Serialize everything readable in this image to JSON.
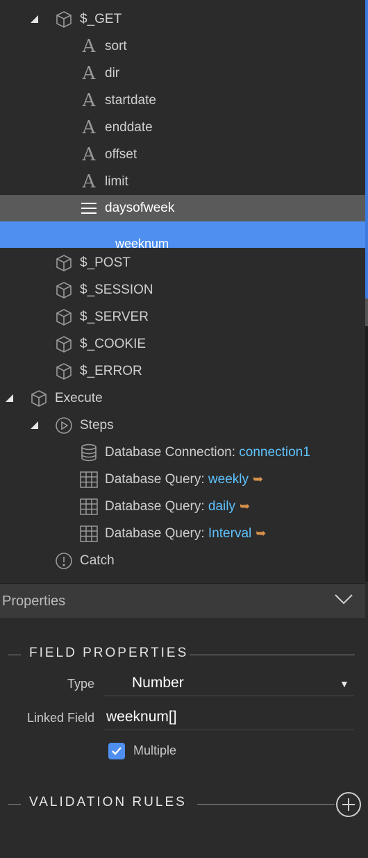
{
  "tree": {
    "get_node": "$_GET",
    "get_children": [
      "sort",
      "dir",
      "startdate",
      "enddate",
      "offset",
      "limit"
    ],
    "selected_item": "daysofweek",
    "highlighted_item": "weeknum",
    "globals": [
      "$_POST",
      "$_SESSION",
      "$_SERVER",
      "$_COOKIE",
      "$_ERROR"
    ],
    "execute_label": "Execute",
    "steps_label": "Steps",
    "steps": [
      {
        "prefix": "Database Connection: ",
        "link": "connection1",
        "arrow": ""
      },
      {
        "prefix": "Database Query: ",
        "link": "weekly",
        "arrow": "➥"
      },
      {
        "prefix": "Database Query: ",
        "link": "daily",
        "arrow": "➥"
      },
      {
        "prefix": "Database Query: ",
        "link": "Interval",
        "arrow": "➥"
      }
    ],
    "catch_label": "Catch"
  },
  "properties": {
    "header": "Properties",
    "field_section": "FIELD PROPERTIES",
    "type_label": "Type",
    "type_value": "Number",
    "linked_field_label": "Linked Field",
    "linked_field_value": "weeknum[]",
    "multiple_label": "Multiple",
    "multiple_checked": true,
    "validation_section": "VALIDATION RULES"
  },
  "colors": {
    "background": "#2b2b2b",
    "selected_row": "#5a5a5a",
    "highlight_row": "#4e8ff0",
    "link": "#5fc3ff",
    "arrow": "#d8924a"
  }
}
